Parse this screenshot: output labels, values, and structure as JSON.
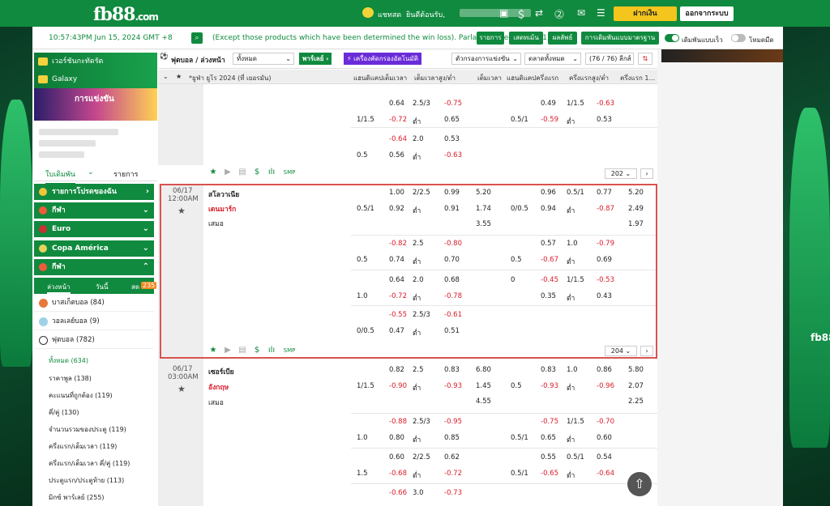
{
  "brand": {
    "name": "fb88",
    "domain_suffix": ".com"
  },
  "topbar": {
    "chat_label": "แชทสด",
    "welcome": "ยินดีต้อนรับ,",
    "deposit_label": "ฝากเงิน",
    "logout_label": "ออกจากระบบ"
  },
  "infobar": {
    "time": "10:57:43PM Jun 15, 2024 GMT +8",
    "notice": "(Except those products which have been determined the win loss). Parlay counted as one(1).",
    "btn_list": "รายการ",
    "btn_stats": "เสตทเม้น",
    "btn_results": "ผลลัพธ์",
    "btn_bet_settings": "การเดิมพันแบบมาตรฐาน",
    "toggle_quick": "เดิมพันแบบเร็ว",
    "toggle_dark": "โหมดมืด"
  },
  "sidebar": {
    "banner_virtual": "เวอร์ชันกะทัดรัด",
    "banner_galaxy": "Galaxy",
    "promo_text": "การแข่งขัน",
    "tab_bets": "ใบเดิมพัน",
    "tab_list": "รายการ",
    "sections": [
      "รายการโปรดของฉัน",
      "กีฬา",
      "Euro",
      "Copa América",
      "กีฬา"
    ],
    "subtabs": [
      "ล่วงหน้า",
      "วันนี้",
      "สด"
    ],
    "live_badge": "235",
    "sports": [
      {
        "name": "บาสเก็ตบอล (84)"
      },
      {
        "name": "วอลเลย์บอล (9)"
      },
      {
        "name": "ฟุตบอล (782)"
      }
    ],
    "leaves": [
      "ทั้งหมด (634)",
      "ราคาพูล (138)",
      "คะแนนที่ถูกต้อง (119)",
      "คี่/คู่ (130)",
      "จำนวนรวมของประตู (119)",
      "ครึ่งแรก/เต็มเวลา (119)",
      "ครึ่งแรก/เต็มเวลา คี่/คู่ (119)",
      "ประตูแรก/ประตูท้าย (113)",
      "มิกซ์ พาร์เลย์ (255)"
    ]
  },
  "filterbar": {
    "title": "ฟุตบอล / ล่วงหน้า",
    "all_select": "ทั้งหมด",
    "parlay": "พาร์เลย์",
    "quick_filter": "เครื่องคัดกรองอัตโนมัติ",
    "league_filter": "ตัวกรองการแข่งขัน",
    "market_select": "ตลาดทั้งหมด",
    "league_count": "(76 / 76) ลีกส์"
  },
  "columns": {
    "league": "*ยูฟ่า ยูโร 2024 (ที่ เยอรมัน)",
    "hdp_ft": "แฮนดิแคปเต็มเวลา",
    "ou_ft": "เต็มเวลาสูง/ต่ำ",
    "x12_ft": "เต็มเวลา",
    "hdp_h1": "แฮนดิแคปครึ่งแรก",
    "ou_h1": "ครึ่งแรกสูง/ต่ำ",
    "x12_h1": "ครึ่งแรก 1..."
  },
  "prev_block": {
    "rows": [
      {
        "a": "",
        "b": "0.64",
        "c": "2.5/3",
        "d": "-0.75",
        "e": "",
        "f": "0.49",
        "g": "1/1.5",
        "h": "-0.63"
      },
      {
        "a": "1/1.5",
        "b": "-0.72",
        "c": "ต่ำ",
        "d": "0.65",
        "e": "0.5/1",
        "f": "-0.59",
        "g": "ต่ำ",
        "h": "0.53"
      },
      {
        "a": "",
        "b": "-0.64",
        "c": "2.0",
        "d": "0.53",
        "e": "",
        "f": "",
        "g": "",
        "h": ""
      },
      {
        "a": "0.5",
        "b": "0.56",
        "c": "ต่ำ",
        "d": "-0.63",
        "e": "",
        "f": "",
        "g": "",
        "h": ""
      }
    ],
    "count": "202"
  },
  "match1": {
    "date": "06/17",
    "time": "12:00AM",
    "home": "สโลวาเนีย",
    "away": "เดนมาร์ก",
    "draw": "เสมอ",
    "main_rows": [
      {
        "hdp": "",
        "hdp_odd": "1.00",
        "ou": "2/2.5",
        "ou_odd": "0.99",
        "x12": "5.20",
        "h1hdp": "",
        "h1hdp_odd": "0.96",
        "h1ou": "0.5/1",
        "h1ou_odd": "0.77",
        "h1x": "5.20"
      },
      {
        "hdp": "0.5/1",
        "hdp_odd": "0.92",
        "ou": "ต่ำ",
        "ou_odd": "0.91",
        "x12": "1.74",
        "h1hdp": "0/0.5",
        "h1hdp_odd": "0.94",
        "h1ou": "ต่ำ",
        "h1ou_odd": "-0.87",
        "h1x": "2.49"
      },
      {
        "hdp": "",
        "hdp_odd": "",
        "ou": "",
        "ou_odd": "",
        "x12": "3.55",
        "h1hdp": "",
        "h1hdp_odd": "",
        "h1ou": "",
        "h1ou_odd": "",
        "h1x": "1.97"
      }
    ],
    "alt_rows": [
      {
        "hdp": "",
        "hdp_odd": "-0.82",
        "ou": "2.5",
        "ou_odd": "-0.80",
        "h1hdp": "",
        "h1hdp_odd": "0.57",
        "h1ou": "1.0",
        "h1ou_odd": "-0.79"
      },
      {
        "hdp": "0.5",
        "hdp_odd": "0.74",
        "ou": "ต่ำ",
        "ou_odd": "0.70",
        "h1hdp": "0.5",
        "h1hdp_odd": "-0.67",
        "h1ou": "ต่ำ",
        "h1ou_odd": "0.69"
      },
      {
        "hdp": "",
        "hdp_odd": "0.64",
        "ou": "2.0",
        "ou_odd": "0.68",
        "h1hdp": "0",
        "h1hdp_odd": "-0.45",
        "h1ou": "1/1.5",
        "h1ou_odd": "-0.53"
      },
      {
        "hdp": "1.0",
        "hdp_odd": "-0.72",
        "ou": "ต่ำ",
        "ou_odd": "-0.78",
        "h1hdp": "",
        "h1hdp_odd": "0.35",
        "h1ou": "ต่ำ",
        "h1ou_odd": "0.43"
      },
      {
        "hdp": "",
        "hdp_odd": "-0.55",
        "ou": "2.5/3",
        "ou_odd": "-0.61",
        "h1hdp": "",
        "h1hdp_odd": "",
        "h1ou": "",
        "h1ou_odd": ""
      },
      {
        "hdp": "0/0.5",
        "hdp_odd": "0.47",
        "ou": "ต่ำ",
        "ou_odd": "0.51",
        "h1hdp": "",
        "h1hdp_odd": "",
        "h1ou": "",
        "h1ou_odd": ""
      }
    ],
    "count": "204"
  },
  "match2": {
    "date": "06/17",
    "time": "03:00AM",
    "home": "เซอร์เบีย",
    "away": "อังกฤษ",
    "draw": "เสมอ",
    "main_rows": [
      {
        "hdp": "",
        "hdp_odd": "0.82",
        "ou": "2.5",
        "ou_odd": "0.83",
        "x12": "6.80",
        "h1hdp": "",
        "h1hdp_odd": "0.83",
        "h1ou": "1.0",
        "h1ou_odd": "0.86",
        "h1x": "5.80"
      },
      {
        "hdp": "1/1.5",
        "hdp_odd": "-0.90",
        "ou": "ต่ำ",
        "ou_odd": "-0.93",
        "x12": "1.45",
        "h1hdp": "0.5",
        "h1hdp_odd": "-0.93",
        "h1ou": "ต่ำ",
        "h1ou_odd": "-0.96",
        "h1x": "2.07"
      },
      {
        "hdp": "",
        "hdp_odd": "",
        "ou": "",
        "ou_odd": "",
        "x12": "4.55",
        "h1hdp": "",
        "h1hdp_odd": "",
        "h1ou": "",
        "h1ou_odd": "",
        "h1x": "2.25"
      }
    ],
    "alt_rows": [
      {
        "hdp": "",
        "hdp_odd": "-0.88",
        "ou": "2.5/3",
        "ou_odd": "-0.95",
        "h1hdp": "",
        "h1hdp_odd": "-0.75",
        "h1ou": "1/1.5",
        "h1ou_odd": "-0.70"
      },
      {
        "hdp": "1.0",
        "hdp_odd": "0.80",
        "ou": "ต่ำ",
        "ou_odd": "0.85",
        "h1hdp": "0.5/1",
        "h1hdp_odd": "0.65",
        "h1ou": "ต่ำ",
        "h1ou_odd": "0.60"
      },
      {
        "hdp": "",
        "hdp_odd": "0.60",
        "ou": "2/2.5",
        "ou_odd": "0.62",
        "h1hdp": "",
        "h1hdp_odd": "0.55",
        "h1ou": "0.5/1",
        "h1ou_odd": "0.54"
      },
      {
        "hdp": "1.5",
        "hdp_odd": "-0.68",
        "ou": "ต่ำ",
        "ou_odd": "-0.72",
        "h1hdp": "0.5/1",
        "h1hdp_odd": "-0.65",
        "h1ou": "ต่ำ",
        "h1ou_odd": "-0.64"
      },
      {
        "hdp": "",
        "hdp_odd": "-0.66",
        "ou": "3.0",
        "ou_odd": "-0.73",
        "h1hdp": "",
        "h1hdp_odd": "",
        "h1ou": "",
        "h1ou_odd": ""
      }
    ]
  },
  "smp_label": "SMP",
  "colors": {
    "brand_green": "#108a3e",
    "negative_red": "#d91c2a",
    "highlight_border": "#d9534f",
    "deposit_yellow": "#f4c51d"
  }
}
